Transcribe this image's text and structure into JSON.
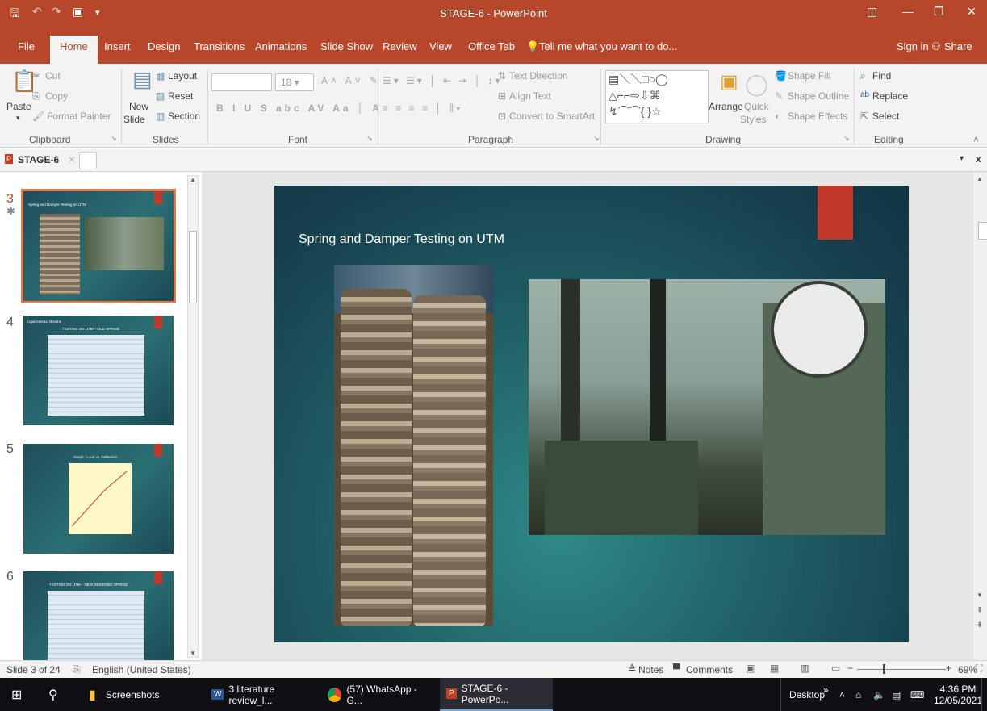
{
  "window": {
    "title": "STAGE-6 - PowerPoint"
  },
  "tabs": {
    "file": "File",
    "home": "Home",
    "insert": "Insert",
    "design": "Design",
    "transitions": "Transitions",
    "animations": "Animations",
    "slideshow": "Slide Show",
    "review": "Review",
    "view": "View",
    "officetab": "Office Tab",
    "tellme": "Tell me what you want to do...",
    "signin": "Sign in",
    "share": "Share"
  },
  "ribbon": {
    "clipboard": {
      "cut": "Cut",
      "copy": "Copy",
      "paste": "Paste",
      "format_painter": "Format Painter",
      "label": "Clipboard"
    },
    "slides": {
      "layout": "Layout",
      "reset": "Reset",
      "section": "Section",
      "new_slide_1": "New",
      "new_slide_2": "Slide",
      "label": "Slides"
    },
    "font": {
      "size": "18",
      "label": "Font"
    },
    "paragraph": {
      "text_direction": "Text Direction",
      "align_text": "Align Text",
      "convert": "Convert to SmartArt",
      "label": "Paragraph"
    },
    "drawing": {
      "arrange": "Arrange",
      "quick": "Quick",
      "styles": "Styles",
      "shape_fill": "Shape Fill",
      "shape_outline": "Shape Outline",
      "shape_effects": "Shape Effects",
      "label": "Drawing"
    },
    "editing": {
      "find": "Find",
      "replace": "Replace",
      "select": "Select",
      "label": "Editing"
    }
  },
  "doctab": {
    "name": "STAGE-6"
  },
  "thumbnails": [
    {
      "num": "3",
      "title": "Spring and Damper Testing on UTM"
    },
    {
      "num": "4",
      "title": "Experimental Results",
      "subtitle": "TESTING ON UTM – OLD SPRING"
    },
    {
      "num": "5",
      "title": "Graph : Load vs. Deflection"
    },
    {
      "num": "6",
      "title": "TESTING ON UTM – NEW DESIGNED SPRING"
    }
  ],
  "slide": {
    "title": "Spring and Damper Testing on UTM"
  },
  "status": {
    "slide": "Slide 3 of 24",
    "language": "English (United States)",
    "notes": "Notes",
    "comments": "Comments",
    "zoom": "69%"
  },
  "taskbar": {
    "screenshots": "Screenshots",
    "word": "3 literature review_l...",
    "whatsapp": "(57) WhatsApp - G...",
    "ppt": "STAGE-6 - PowerPo...",
    "desktop": "Desktop",
    "time": "4:36 PM",
    "date": "12/05/2021"
  },
  "colors": {
    "accent": "#b7472a",
    "slide_bg": "#1e5b63",
    "red_tab": "#c0392b"
  }
}
